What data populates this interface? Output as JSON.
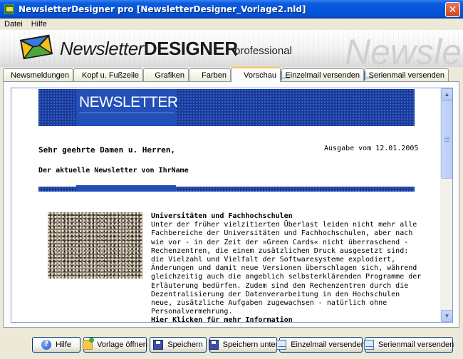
{
  "window": {
    "title": "NewsletterDesigner pro [NewsletterDesigner_Vorlage2.nld]",
    "close_label": "✕"
  },
  "menu": {
    "items": [
      "Datei",
      "Hilfe"
    ]
  },
  "banner": {
    "logo_prefix": "Newsletter",
    "logo_strong": "DESIGNER",
    "logo_sub": "professional",
    "watermark": "Newsle"
  },
  "tabs": [
    {
      "label": "Newsmeldungen",
      "icon": ""
    },
    {
      "label": "Kopf u. Fußzeile",
      "icon": ""
    },
    {
      "label": "Grafiken",
      "icon": ""
    },
    {
      "label": "Farben",
      "icon": ""
    },
    {
      "label": "Vorschau",
      "icon": "",
      "active": true
    },
    {
      "label": "Einzelmail versenden",
      "icon": "mail-icon"
    },
    {
      "label": "Serienmail versenden",
      "icon": "mail-icon"
    }
  ],
  "newsletter": {
    "header_title": "NEWSLETTER",
    "salutation": "Sehr geehrte Damen u. Herren,",
    "issue_date": "Ausgabe vom 12.01.2005",
    "subtitle": "Der aktuelle Newsletter von IhrName",
    "article": {
      "heading": "Universitäten und Fachhochschulen",
      "body": "Unter der früher vielzitierten Überlast leiden nicht mehr alle Fachbereiche der Universitäten und Fachhochschulen, aber nach wie vor - in der Zeit der »Green Cards« nicht überraschend - Rechenzentren, die einem zusätzlichen Druck ausgesetzt sind: die Vielzahl und Vielfalt der Softwaresysteme explodiert, Änderungen und damit neue Versionen überschlagen sich, während gleichzeitig auch die angeblich selbsterklärenden Programme der Erläuterung bedürfen. Zudem sind den Rechenzentren durch die Dezentralisierung der Datenverarbeitung in den Hochschulen neue, zusätzliche Aufgaben zugewachsen - natürlich ohne Personalvermehrung.",
      "link": "Hier Klicken für mehr Information"
    }
  },
  "buttons": [
    {
      "label": "Hilfe",
      "icon": "help-icon"
    },
    {
      "label": "Vorlage öffnen",
      "icon": "open-icon"
    },
    {
      "label": "Speichern",
      "icon": "save-icon"
    },
    {
      "label": "Speichern unter",
      "icon": "save-as-icon"
    },
    {
      "label": "Einzelmail versenden",
      "icon": "mail-icon"
    },
    {
      "label": "Serienmail versenden",
      "icon": "mail-icon"
    }
  ],
  "colors": {
    "titlebar": "#0454dc",
    "newsletter_blue": "#183a9a",
    "tab_highlight": "#ffc83c"
  }
}
